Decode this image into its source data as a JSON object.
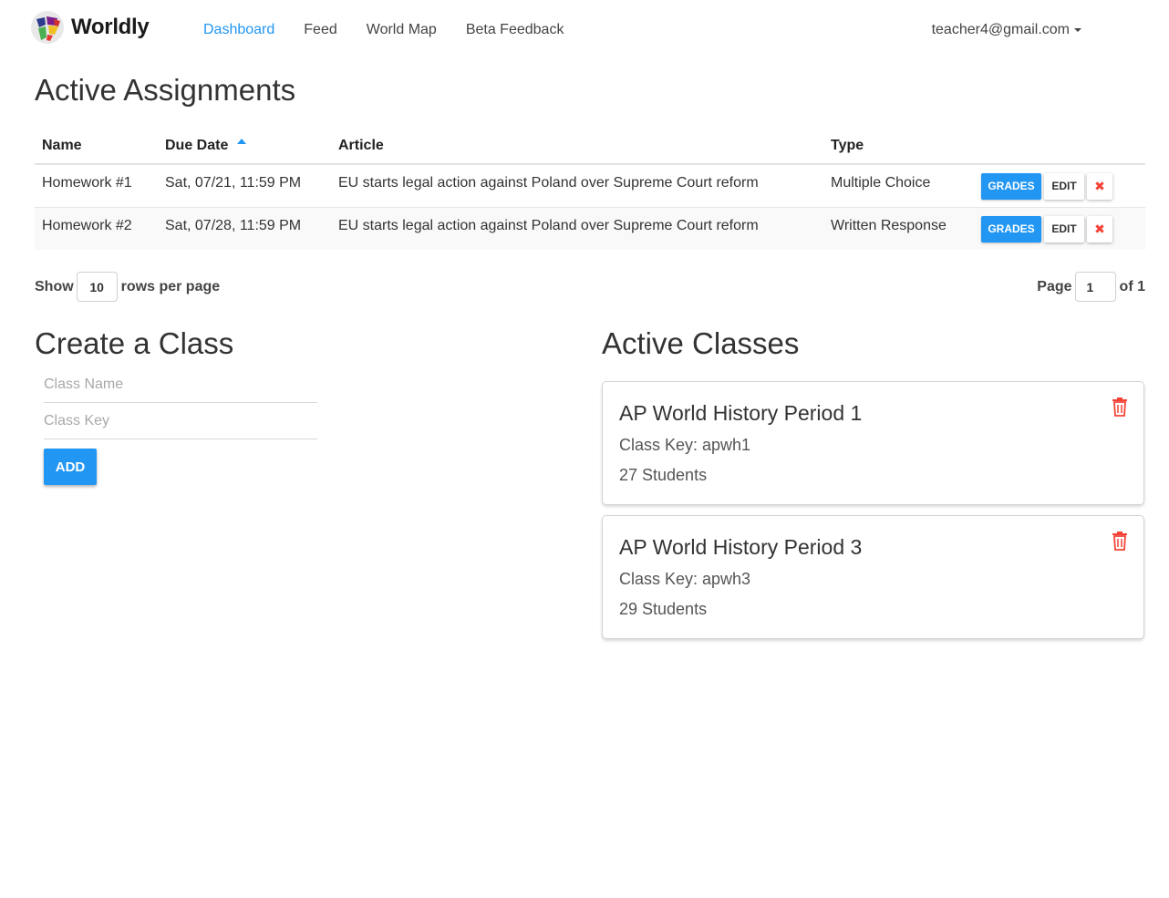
{
  "nav": {
    "brand": "Worldly",
    "links": [
      "Dashboard",
      "Feed",
      "World Map",
      "Beta Feedback"
    ],
    "user": "teacher4@gmail.com",
    "accent": "#2196f3"
  },
  "assignments": {
    "title": "Active Assignments",
    "columns": [
      "Name",
      "Due Date",
      "Article",
      "Type"
    ],
    "rows": [
      {
        "name": "Homework #1",
        "due": "Sat, 07/21, 11:59 PM",
        "article": "EU starts legal action against Poland over Supreme Court reform",
        "type": "Multiple Choice"
      },
      {
        "name": "Homework #2",
        "due": "Sat, 07/28, 11:59 PM",
        "article": "EU starts legal action against Poland over Supreme Court reform",
        "type": "Written Response"
      }
    ],
    "actions": {
      "grades": "GRADES",
      "edit": "EDIT",
      "delete": "✖"
    }
  },
  "pagination": {
    "show_label": "Show",
    "rows_value": "10",
    "rows_suffix": "rows per page",
    "page_label": "Page",
    "page_value": "1",
    "page_total": "of 1"
  },
  "create_class": {
    "title": "Create a Class",
    "class_name_placeholder": "Class Name",
    "class_key_placeholder": "Class Key",
    "add_label": "ADD"
  },
  "active_classes": {
    "title": "Active Classes",
    "classes": [
      {
        "name": "AP World History Period 1",
        "key": "Class Key: apwh1",
        "count": "27 Students"
      },
      {
        "name": "AP World History Period 3",
        "key": "Class Key: apwh3",
        "count": "29 Students"
      }
    ],
    "delete_color": "#f44336"
  }
}
